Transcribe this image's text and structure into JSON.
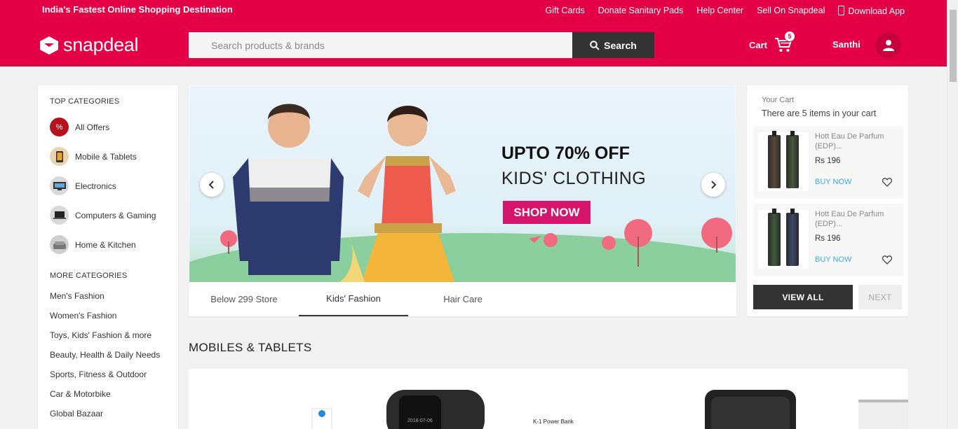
{
  "topbar": {
    "tagline": "India's Fastest Online Shopping Destination",
    "links": [
      "Gift Cards",
      "Donate Sanitary Pads",
      "Help Center",
      "Sell On Snapdeal",
      "Download App"
    ]
  },
  "header": {
    "logo_text": "snapdeal",
    "search_placeholder": "Search products & brands",
    "search_button": "Search",
    "cart_label": "Cart",
    "cart_count": "5",
    "user_name": "Santhi"
  },
  "sidebar": {
    "top_title": "TOP CATEGORIES",
    "top_categories": [
      {
        "label": "All Offers",
        "icon": "offers-icon",
        "color": "#b5121b"
      },
      {
        "label": "Mobile & Tablets",
        "icon": "mobile-icon",
        "color": "#8a5a2b"
      },
      {
        "label": "Electronics",
        "icon": "electronics-icon",
        "color": "#444444"
      },
      {
        "label": "Computers & Gaming",
        "icon": "computer-icon",
        "color": "#555555"
      },
      {
        "label": "Home & Kitchen",
        "icon": "home-icon",
        "color": "#777777"
      }
    ],
    "more_title": "MORE CATEGORIES",
    "more_categories": [
      "Men's Fashion",
      "Women's Fashion",
      "Toys, Kids' Fashion & more",
      "Beauty, Health & Daily Needs",
      "Sports, Fitness & Outdoor",
      "Car & Motorbike",
      "Global Bazaar"
    ]
  },
  "banner": {
    "line1": "UPTO 70% OFF",
    "line2": "KIDS' CLOTHING",
    "cta": "SHOP NOW",
    "tabs": [
      "Below 299 Store",
      "Kids' Fashion",
      "Hair Care"
    ],
    "active_tab": "Kids' Fashion"
  },
  "cart_panel": {
    "title": "Your Cart",
    "subtitle": "There are 5 items in your cart",
    "items": [
      {
        "name": "Hott Eau De Parfum (EDP)...",
        "price": "Rs 196",
        "buy": "BUY NOW"
      },
      {
        "name": "Hott Eau De Parfum (EDP)...",
        "price": "Rs 196",
        "buy": "BUY NOW"
      }
    ],
    "view_all": "VIEW ALL",
    "next": "NEXT"
  },
  "section": {
    "mobiles_title": "MOBILES & TABLETS",
    "product_label": "K-1 Power Bank"
  },
  "colors": {
    "brand": "#e40046",
    "dark": "#333333",
    "link": "#3fa9dd",
    "cta": "#d6146b"
  }
}
